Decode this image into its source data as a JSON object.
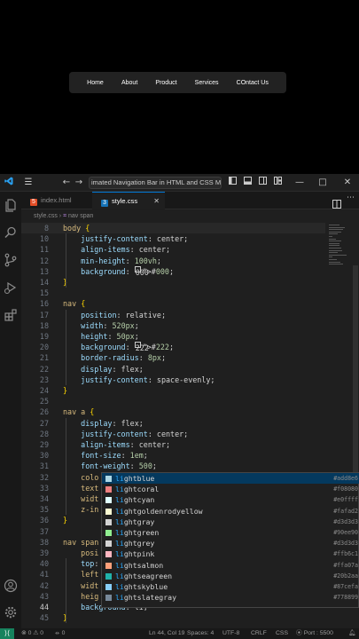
{
  "preview": {
    "nav_links": [
      "Home",
      "About",
      "Product",
      "Services",
      "COntact Us"
    ]
  },
  "titlebar": {
    "command_center": "imated Navigation Bar in HTML and CSS Mo"
  },
  "tabs": [
    {
      "label": "index.html",
      "active": false
    },
    {
      "label": "style.css",
      "active": true
    }
  ],
  "breadcrumb": [
    "style.css",
    "nav span"
  ],
  "code": {
    "lines": [
      {
        "n": "8",
        "t": "body {"
      },
      {
        "n": "10",
        "t": "    justify-content: center;"
      },
      {
        "n": "11",
        "t": "    align-items: center;"
      },
      {
        "n": "12",
        "t": "    min-height: 100vh;"
      },
      {
        "n": "13",
        "t": "    background: #000;"
      },
      {
        "n": "14",
        "t": "}"
      },
      {
        "n": "15",
        "t": ""
      },
      {
        "n": "16",
        "t": "nav {"
      },
      {
        "n": "17",
        "t": "    position: relative;"
      },
      {
        "n": "18",
        "t": "    width: 520px;"
      },
      {
        "n": "19",
        "t": "    height: 50px;"
      },
      {
        "n": "20",
        "t": "    background: #222;"
      },
      {
        "n": "21",
        "t": "    border-radius: 8px;"
      },
      {
        "n": "22",
        "t": "    display: flex;"
      },
      {
        "n": "23",
        "t": "    justify-content: space-evenly;"
      },
      {
        "n": "24",
        "t": "}"
      },
      {
        "n": "25",
        "t": ""
      },
      {
        "n": "26",
        "t": "nav a {"
      },
      {
        "n": "27",
        "t": "    display: flex;"
      },
      {
        "n": "28",
        "t": "    justify-content: center;"
      },
      {
        "n": "29",
        "t": "    align-items: center;"
      },
      {
        "n": "30",
        "t": "    font-size: 1em;"
      },
      {
        "n": "31",
        "t": "    font-weight: 500;"
      },
      {
        "n": "32",
        "t": "    colo"
      },
      {
        "n": "33",
        "t": "    text"
      },
      {
        "n": "34",
        "t": "    widt"
      },
      {
        "n": "35",
        "t": "    z-in"
      },
      {
        "n": "36",
        "t": "}"
      },
      {
        "n": "37",
        "t": ""
      },
      {
        "n": "38",
        "t": "nav span"
      },
      {
        "n": "39",
        "t": "    posi"
      },
      {
        "n": "40",
        "t": "    top:"
      },
      {
        "n": "41",
        "t": "    left"
      },
      {
        "n": "42",
        "t": "    widt"
      },
      {
        "n": "43",
        "t": "    heig"
      },
      {
        "n": "44",
        "t": "    background: li;"
      },
      {
        "n": "45",
        "t": "}"
      }
    ]
  },
  "suggestions": [
    {
      "label": "lightblue",
      "hex": "#add8e6",
      "color": "#add8e6",
      "selected": true
    },
    {
      "label": "lightcoral",
      "hex": "#f08080",
      "color": "#f08080",
      "selected": false
    },
    {
      "label": "lightcyan",
      "hex": "#e0ffff",
      "color": "#e0ffff",
      "selected": false
    },
    {
      "label": "lightgoldenrodyellow",
      "hex": "#fafad2",
      "color": "#fafad2",
      "selected": false
    },
    {
      "label": "lightgray",
      "hex": "#d3d3d3",
      "color": "#d3d3d3",
      "selected": false
    },
    {
      "label": "lightgreen",
      "hex": "#90ee90",
      "color": "#90ee90",
      "selected": false
    },
    {
      "label": "lightgrey",
      "hex": "#d3d3d3",
      "color": "#d3d3d3",
      "selected": false
    },
    {
      "label": "lightpink",
      "hex": "#ffb6c1",
      "color": "#ffb6c1",
      "selected": false
    },
    {
      "label": "lightsalmon",
      "hex": "#ffa07a",
      "color": "#ffa07a",
      "selected": false
    },
    {
      "label": "lightseagreen",
      "hex": "#20b2aa",
      "color": "#20b2aa",
      "selected": false
    },
    {
      "label": "lightskyblue",
      "hex": "#87cefa",
      "color": "#87cefa",
      "selected": false
    },
    {
      "label": "lightslategray",
      "hex": "#778899",
      "color": "#778899",
      "selected": false
    }
  ],
  "statusbar": {
    "problems": "0 ⚠ 0",
    "ports": "0",
    "position": "Ln 44, Col 19",
    "spaces": "Spaces: 4",
    "encoding": "UTF-8",
    "eol": "CRLF",
    "language": "CSS",
    "port": "Port : 5500"
  },
  "colors": {
    "accent": "#0078d4",
    "remote": "#16825d",
    "editor_bg": "#1f1f1f"
  }
}
